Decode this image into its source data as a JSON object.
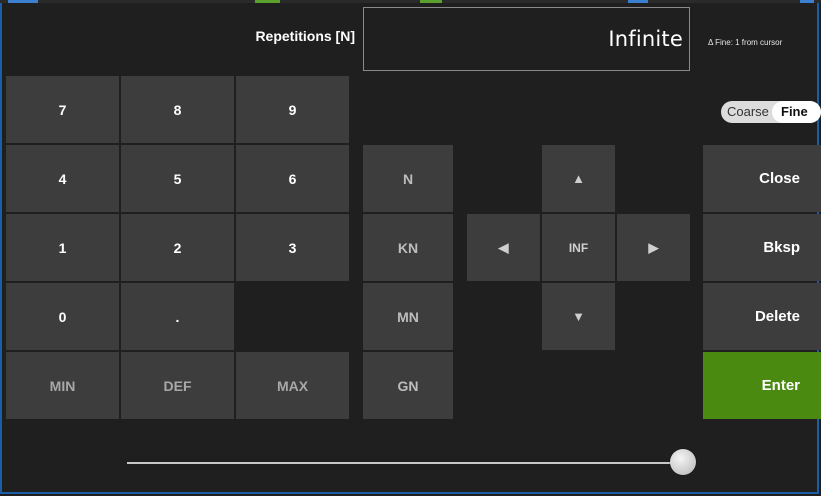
{
  "header": {
    "param_label": "Repetitions [N]",
    "value": "Infinite",
    "hint": "Δ Fine: 1 from cursor"
  },
  "keypad": {
    "rows": [
      [
        "7",
        "8",
        "9"
      ],
      [
        "4",
        "5",
        "6"
      ],
      [
        "1",
        "2",
        "3"
      ],
      [
        "0",
        "."
      ],
      [
        "MIN",
        "DEF",
        "MAX"
      ]
    ]
  },
  "units": [
    "N",
    "KN",
    "MN",
    "GN"
  ],
  "nav": {
    "up": "▲",
    "left": "◀",
    "center": "INF",
    "right": "▶",
    "down": "▼"
  },
  "actions": {
    "close": "Close",
    "bksp": "Bksp",
    "delete": "Delete",
    "enter": "Enter"
  },
  "toggle": {
    "coarse": "Coarse",
    "fine": "Fine",
    "selected": "Fine"
  },
  "slider": {
    "level": 1.0
  },
  "colors": {
    "background": "#1f1f1f",
    "key": "#3d3d3d",
    "enter": "#4a8a11",
    "frame": "#1a5fa6"
  }
}
